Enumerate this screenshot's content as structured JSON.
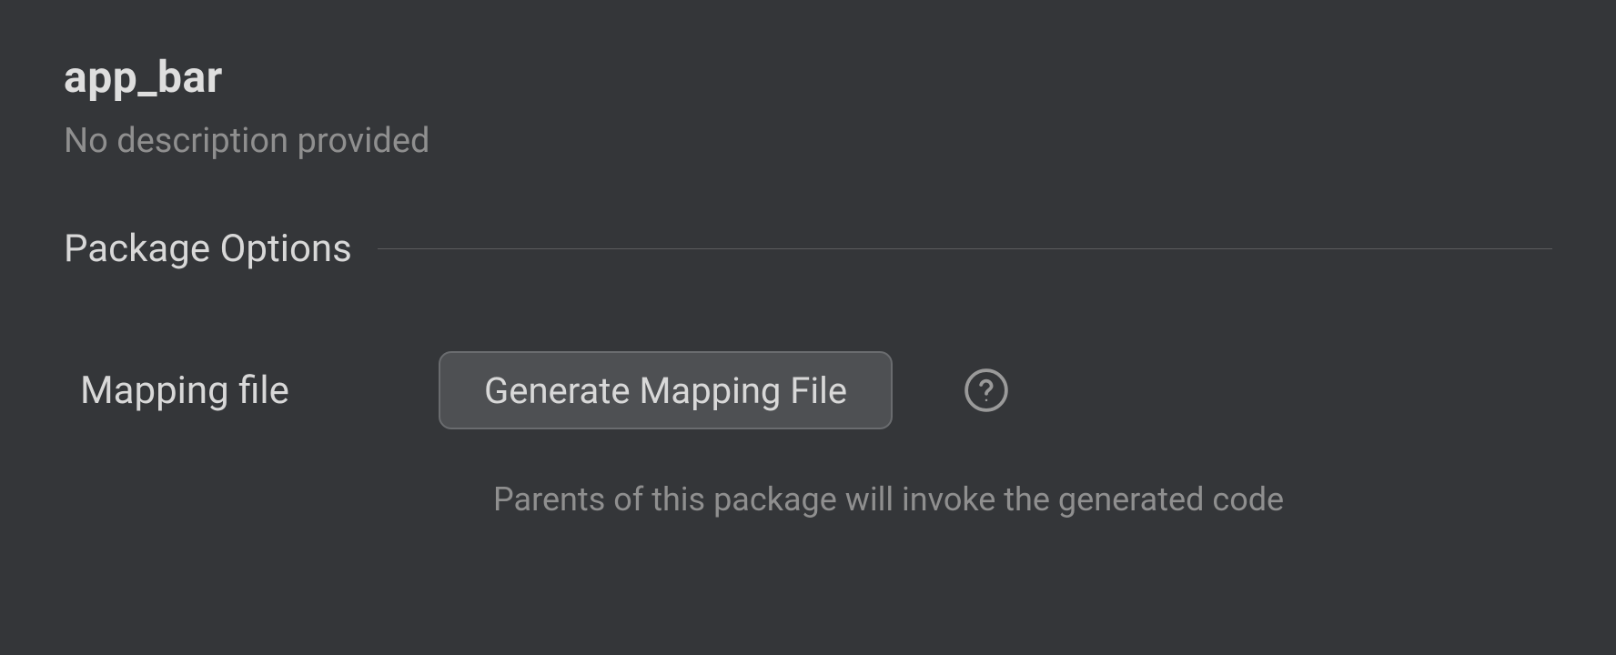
{
  "header": {
    "title": "app_bar",
    "description": "No description provided"
  },
  "section": {
    "title": "Package Options"
  },
  "options": {
    "mapping_file": {
      "label": "Mapping file",
      "button_label": "Generate Mapping File",
      "hint": "Parents of this package will invoke the generated code"
    }
  }
}
